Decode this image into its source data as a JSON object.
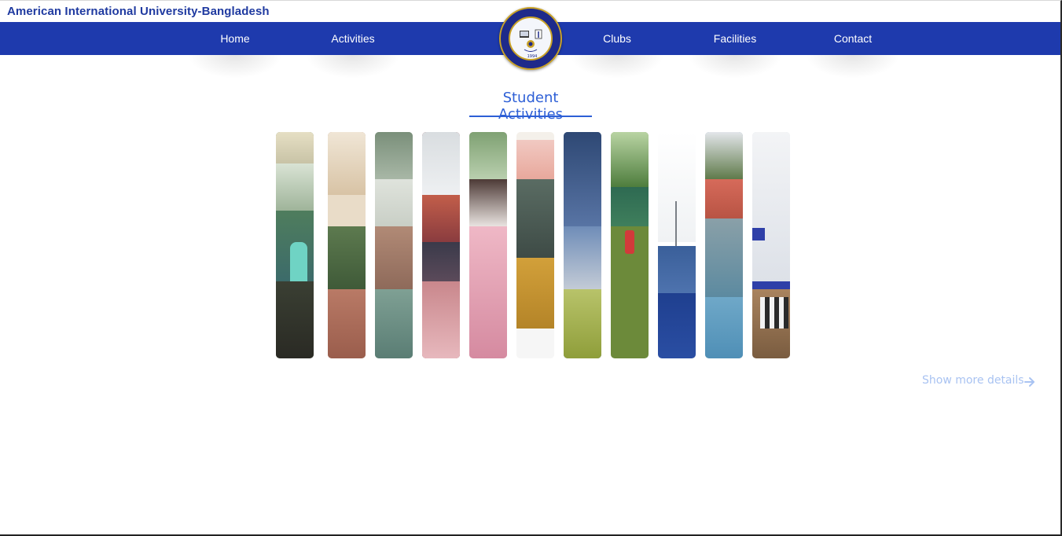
{
  "site": {
    "title": "American International University-Bangladesh"
  },
  "nav": {
    "items": [
      {
        "label": "Home"
      },
      {
        "label": "Activities"
      },
      {
        "label": "Clubs"
      },
      {
        "label": "Facilities"
      },
      {
        "label": "Contact"
      }
    ]
  },
  "logo": {
    "name": "aiub-seal-logo",
    "year": "1994",
    "colors": {
      "ring": "#1e2a8a",
      "gold": "#c9a227"
    }
  },
  "section": {
    "title": "Student Activities"
  },
  "gallery": {
    "images": [
      {
        "name": "activity-photo-canteen"
      },
      {
        "name": "activity-photo-corridor"
      },
      {
        "name": "activity-photo-library"
      },
      {
        "name": "activity-photo-fair"
      },
      {
        "name": "activity-photo-performance"
      },
      {
        "name": "activity-photo-dance"
      },
      {
        "name": "activity-photo-cricket-crowd"
      },
      {
        "name": "activity-photo-football"
      },
      {
        "name": "activity-photo-basketball-team"
      },
      {
        "name": "activity-photo-basketball-court"
      },
      {
        "name": "activity-photo-chess"
      }
    ]
  },
  "cta": {
    "show_more": "Show more details",
    "icon": "arrow-right-icon"
  },
  "colors": {
    "brand": "#1e3aad",
    "accent": "#2d5fd6",
    "link_muted": "#a9c3f2"
  }
}
